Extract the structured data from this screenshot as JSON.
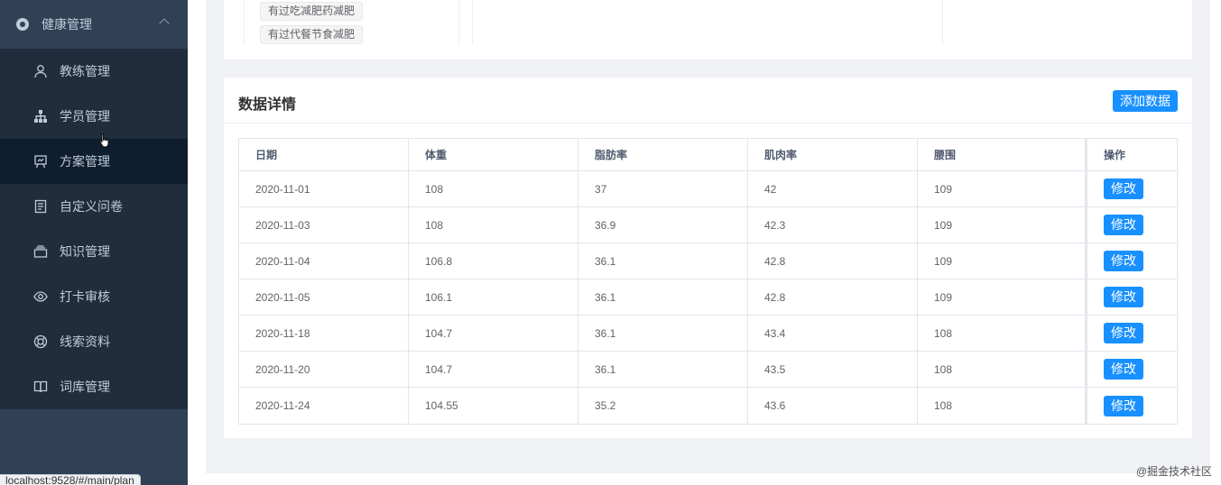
{
  "sidebar": {
    "parent": {
      "label": "健康管理",
      "icon": "health-icon"
    },
    "items": [
      {
        "label": "教练管理",
        "icon": "user-icon"
      },
      {
        "label": "学员管理",
        "icon": "org-tree-icon"
      },
      {
        "label": "方案管理",
        "icon": "easel-icon",
        "active": true
      },
      {
        "label": "自定义问卷",
        "icon": "document-icon"
      },
      {
        "label": "知识管理",
        "icon": "inbox-icon"
      },
      {
        "label": "打卡审核",
        "icon": "eye-icon"
      },
      {
        "label": "线索资料",
        "icon": "lifebuoy-icon"
      },
      {
        "label": "词库管理",
        "icon": "book-icon"
      }
    ]
  },
  "top_tags": [
    "有过吃减肥药减肥",
    "有过代餐节食减肥"
  ],
  "card": {
    "title": "数据详情",
    "add_button": "添加数据",
    "columns": [
      "日期",
      "体重",
      "脂肪率",
      "肌肉率",
      "腰围",
      "操作"
    ],
    "edit_label": "修改",
    "rows": [
      [
        "2020-11-01",
        "108",
        "37",
        "42",
        "109"
      ],
      [
        "2020-11-03",
        "108",
        "36.9",
        "42.3",
        "109"
      ],
      [
        "2020-11-04",
        "106.8",
        "36.1",
        "42.8",
        "109"
      ],
      [
        "2020-11-05",
        "106.1",
        "36.1",
        "42.8",
        "109"
      ],
      [
        "2020-11-18",
        "104.7",
        "36.1",
        "43.4",
        "108"
      ],
      [
        "2020-11-20",
        "104.7",
        "36.1",
        "43.5",
        "108"
      ],
      [
        "2020-11-24",
        "104.55",
        "35.2",
        "43.6",
        "108"
      ]
    ]
  },
  "status_url": "localhost:9528/#/main/plan",
  "watermark": "@掘金技术社区",
  "colors": {
    "sidebar_bg": "#304156",
    "submenu_bg": "#1f2d3d",
    "active_bg": "#0f1e2e",
    "primary": "#1890ff"
  }
}
